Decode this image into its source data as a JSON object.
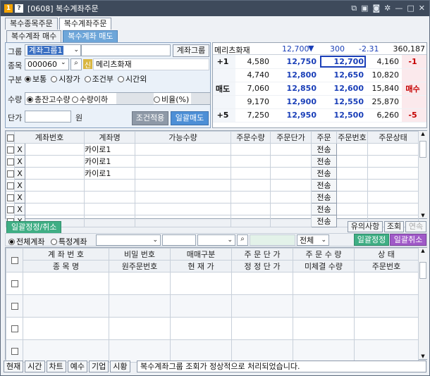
{
  "window": {
    "screen_no": "[0608]",
    "title": "복수계좌주문",
    "icons": [
      "hi-icon",
      "help-icon"
    ],
    "controls": [
      "link-icon",
      "save-icon",
      "capture-icon",
      "settings-icon",
      "minimize-icon",
      "maximize-icon",
      "close-icon"
    ]
  },
  "top_tabs": [
    {
      "label": "복수종목주문"
    },
    {
      "label": "복수계좌주문"
    }
  ],
  "sub_tabs": [
    {
      "label": "복수계좌 매수"
    },
    {
      "label": "복수계좌 매도"
    }
  ],
  "form": {
    "group_label": "그룹",
    "group_value": "계좌그룹1",
    "group_btn": "계좌그룹",
    "stock_label": "종목",
    "stock_code": "000060",
    "credit_badge": "신",
    "stock_name": "메리츠화재",
    "type_label": "구분",
    "types": [
      "보통",
      "시장가",
      "조건부",
      "시간외"
    ],
    "qty_label": "수량",
    "qty_opts": [
      "총잔고수량",
      "수량이하"
    ],
    "ratio_label": "비율(%)",
    "price_label": "단가",
    "price_unit": "원",
    "apply_btn": "조건적용",
    "batch_sell_btn": "일괄매도"
  },
  "quote": {
    "name": "메리츠화재",
    "price": "12,700",
    "arrow": "▼",
    "change": "300",
    "rate": "-2.31",
    "volume": "360,187",
    "rows": [
      {
        "side": "+1",
        "sell_qty": "4,580",
        "sell_price": "12,750",
        "buy_price": "12,700",
        "buy_qty": "4,160",
        "tag": "-1"
      },
      {
        "side": "",
        "sell_qty": "4,740",
        "sell_price": "12,800",
        "buy_price": "12,650",
        "buy_qty": "10,820",
        "tag": ""
      },
      {
        "side": "매도",
        "sell_qty": "7,060",
        "sell_price": "12,850",
        "buy_price": "12,600",
        "buy_qty": "15,840",
        "tag": "매수"
      },
      {
        "side": "",
        "sell_qty": "9,170",
        "sell_price": "12,900",
        "buy_price": "12,550",
        "buy_qty": "25,870",
        "tag": ""
      },
      {
        "side": "+5",
        "sell_qty": "7,250",
        "sell_price": "12,950",
        "buy_price": "12,500",
        "buy_qty": "6,260",
        "tag": "-5"
      }
    ]
  },
  "order_grid": {
    "headers": [
      "계좌번호",
      "계좌명",
      "가능수량",
      "주문수량",
      "주문단가",
      "주문",
      "주문번호",
      "주문상태"
    ],
    "rows": [
      {
        "x": "X",
        "name": "카이로1",
        "btn": "전송"
      },
      {
        "x": "X",
        "name": "카이로1",
        "btn": "전송"
      },
      {
        "x": "X",
        "name": "카이로1",
        "btn": "전송"
      },
      {
        "x": "X",
        "name": "",
        "btn": "전송"
      },
      {
        "x": "X",
        "name": "",
        "btn": "전송"
      },
      {
        "x": "X",
        "name": "",
        "btn": "전송"
      },
      {
        "x": "X",
        "name": "",
        "btn": "전송"
      }
    ]
  },
  "bottom": {
    "tab": "일괄정정/취소",
    "notice_btn": "유의사항",
    "query_btn": "조회",
    "next_btn": "연속",
    "filter_all": "전체계좌",
    "filter_specific": "특정계좌",
    "select_all": "전체",
    "modify_btn": "일괄정정",
    "cancel_btn": "일괄취소",
    "headers_top": [
      "계 좌 번 호",
      "비밀 번호",
      "매매구분",
      "주 문 단 가",
      "주 문 수 량",
      "상   태"
    ],
    "headers_bottom": [
      "종   목   명",
      "원주문번호",
      "현 재 가",
      "정 정 단 가",
      "미체결 수량",
      "주문번호"
    ]
  },
  "status": {
    "buttons": [
      "현재",
      "시간",
      "차트",
      "예수",
      "기업",
      "시황"
    ],
    "message": "복수계좌그룹 조회가 정상적으로 처리되었습니다."
  }
}
